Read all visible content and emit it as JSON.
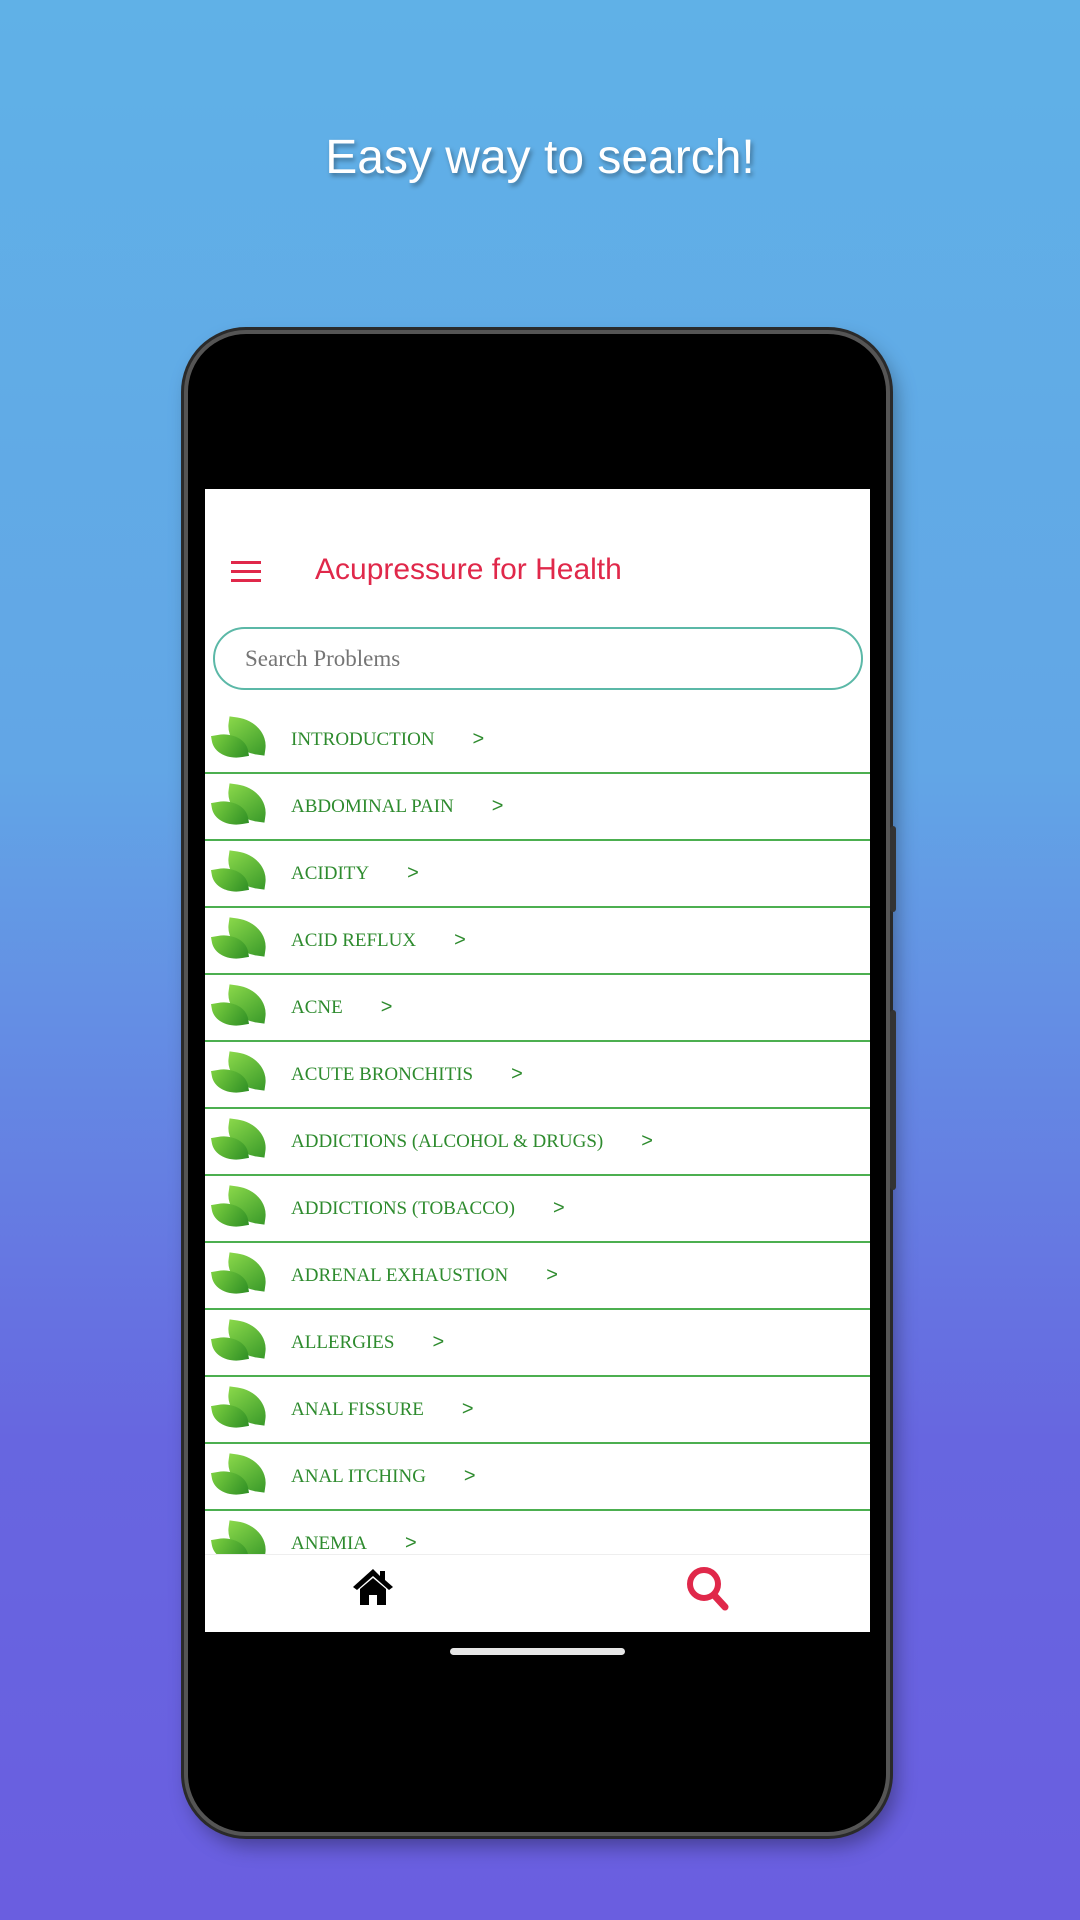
{
  "headline": "Easy way to search!",
  "app": {
    "title": "Acupressure for Health",
    "menu_icon": "hamburger-icon",
    "accent": "#e0284a",
    "list_color": "#2e8b2e"
  },
  "search": {
    "placeholder": "Search Problems",
    "value": ""
  },
  "items": [
    {
      "label": "INTRODUCTION"
    },
    {
      "label": "ABDOMINAL PAIN"
    },
    {
      "label": "ACIDITY"
    },
    {
      "label": "ACID REFLUX"
    },
    {
      "label": "ACNE"
    },
    {
      "label": "ACUTE BRONCHITIS"
    },
    {
      "label": "ADDICTIONS (ALCOHOL & DRUGS)"
    },
    {
      "label": "ADDICTIONS (TOBACCO)"
    },
    {
      "label": "ADRENAL EXHAUSTION"
    },
    {
      "label": "ALLERGIES"
    },
    {
      "label": "ANAL FISSURE"
    },
    {
      "label": "ANAL ITCHING"
    },
    {
      "label": "ANEMIA"
    }
  ],
  "chevron": ">",
  "nav": {
    "home_icon": "home-icon",
    "search_icon": "search-icon"
  }
}
